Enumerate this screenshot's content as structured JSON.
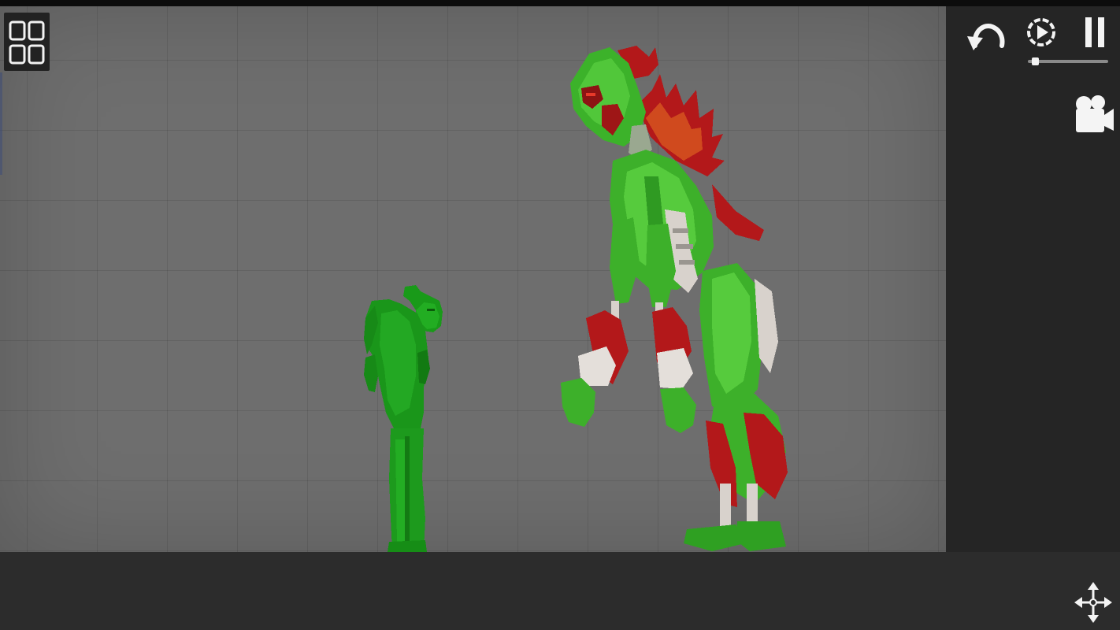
{
  "game": {
    "scene": "sandbox",
    "icons": {
      "menu": "grid-menu-icon",
      "undo": "undo-arrow-icon",
      "slow_motion": "slow-motion-icon",
      "pause": "pause-icon",
      "camera": "camera-icon",
      "move": "move-arrows-icon"
    },
    "time_scale": 0.05,
    "colors": {
      "background_grid": "#6e6e6e",
      "panel": "#252525",
      "floor": "#2c2c2c",
      "melon_green": "#1f9a1f",
      "mutant_green": "#3fbf2a",
      "blood_red": "#b11a1a",
      "bone": "#d8d2cc"
    }
  }
}
